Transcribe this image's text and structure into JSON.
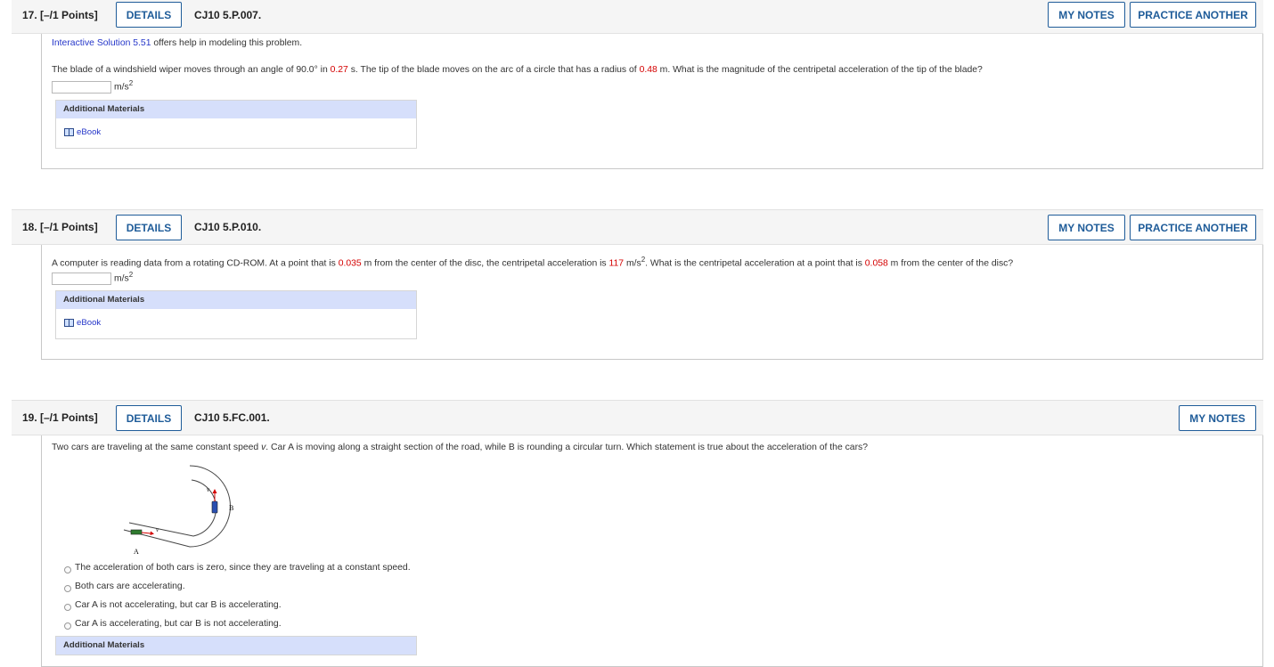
{
  "questions": [
    {
      "number": "17.  [–/1 Points]",
      "details_label": "DETAILS",
      "code": "CJ10 5.P.007.",
      "my_notes_label": "MY NOTES",
      "practice_label": "PRACTICE ANOTHER",
      "help_link": "Interactive Solution 5.51",
      "help_rest": " offers help in modeling this problem.",
      "text": {
        "p1": "The blade of a windshield wiper moves through an angle of 90.0° in ",
        "v1": "0.27",
        "p2": " s. The tip of the blade moves on the arc of a circle that has a radius of ",
        "v2": "0.48",
        "p3": " m. What is the magnitude of the centripetal acceleration of the tip of the blade?"
      },
      "answer_value": "",
      "unit": "m/s",
      "unit_sup": "2",
      "materials_title": "Additional Materials",
      "ebook_label": "eBook"
    },
    {
      "number": "18.  [–/1 Points]",
      "details_label": "DETAILS",
      "code": "CJ10 5.P.010.",
      "my_notes_label": "MY NOTES",
      "practice_label": "PRACTICE ANOTHER",
      "text": {
        "p1": "A computer is reading data from a rotating CD-ROM. At a point that is ",
        "v1": "0.035",
        "p2": " m from the center of the disc, the centripetal acceleration is ",
        "v2": "117",
        "p3": " m/s",
        "p3sup": "2",
        "p4": ". What is the centripetal acceleration at a point that is ",
        "v3": "0.058",
        "p5": " m from the center of the disc?"
      },
      "answer_value": "",
      "unit": "m/s",
      "unit_sup": "2",
      "materials_title": "Additional Materials",
      "ebook_label": "eBook"
    },
    {
      "number": "19.  [–/1 Points]",
      "details_label": "DETAILS",
      "code": "CJ10 5.FC.001.",
      "my_notes_label": "MY NOTES",
      "text": {
        "p1": "Two cars are traveling at the same constant speed ",
        "v": "v",
        "p2": ". Car A is moving along a straight section of the road, while B is rounding a circular turn. Which statement is true about the acceleration of the cars?"
      },
      "figure": {
        "label_a": "A",
        "label_b": "B",
        "label_v": "v"
      },
      "options": [
        "The acceleration of both cars is zero, since they are traveling at a constant speed.",
        "Both cars are accelerating.",
        "Car A is not accelerating, but car B is accelerating.",
        "Car A is accelerating, but car B is not accelerating."
      ],
      "materials_title": "Additional Materials"
    }
  ],
  "colors": {
    "button": "#1f5c99",
    "link": "#2536c9",
    "value": "#d40000",
    "materials_header": "#d6dffb"
  }
}
